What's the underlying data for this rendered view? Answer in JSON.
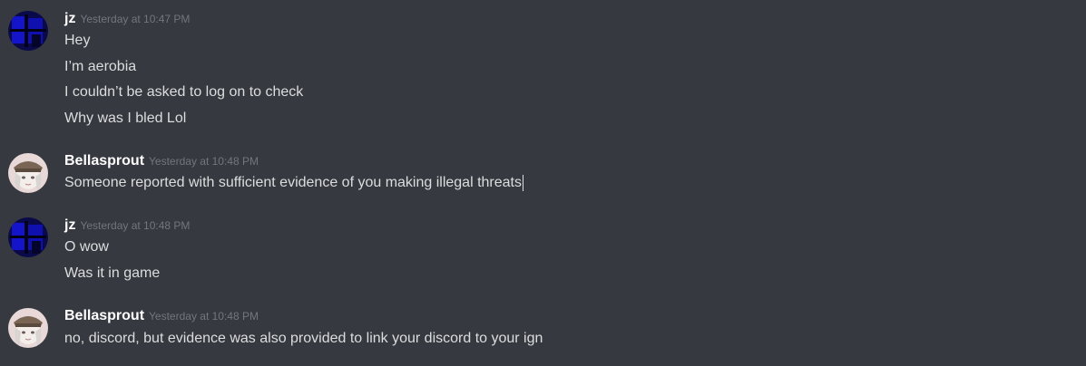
{
  "messages": [
    {
      "author": "jz",
      "timestamp": "Yesterday at 10:47 PM",
      "avatar": "dark-blue-square-avatar",
      "lines": [
        "Hey",
        "I’m aerobia",
        "I couldn’t be asked to log on to check",
        "Why was I bled Lol"
      ]
    },
    {
      "author": "Bellasprout",
      "timestamp": "Yesterday at 10:48 PM",
      "avatar": "anime-character-avatar",
      "lines": [
        "Someone reported with sufficient evidence of you making illegal threats"
      ]
    },
    {
      "author": "jz",
      "timestamp": "Yesterday at 10:48 PM",
      "avatar": "dark-blue-square-avatar",
      "lines": [
        "O wow",
        "Was it in game"
      ]
    },
    {
      "author": "Bellasprout",
      "timestamp": "Yesterday at 10:48 PM",
      "avatar": "anime-character-avatar",
      "lines": [
        "no, discord, but evidence was also provided to link your discord to your ign"
      ]
    }
  ],
  "colors": {
    "background": "#36393f",
    "username": "#ffffff",
    "timestamp": "#72767d",
    "message_text": "#dcddde"
  }
}
